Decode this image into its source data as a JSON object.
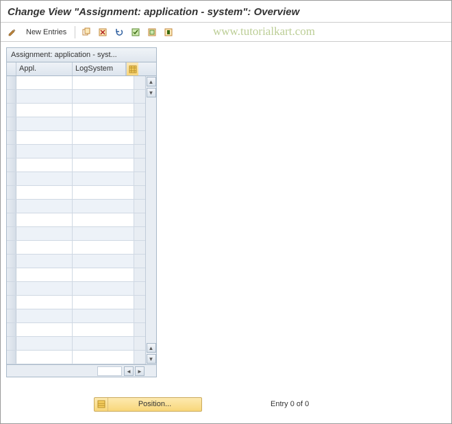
{
  "title": "Change View \"Assignment: application - system\": Overview",
  "watermark": "www.tutorialkart.com",
  "toolbar": {
    "new_entries_label": "New Entries"
  },
  "table": {
    "title": "Assignment: application - syst...",
    "col1": "Appl.",
    "col2": "LogSystem",
    "rows": [
      {
        "appl": "",
        "logsys": ""
      },
      {
        "appl": "",
        "logsys": ""
      },
      {
        "appl": "",
        "logsys": ""
      },
      {
        "appl": "",
        "logsys": ""
      },
      {
        "appl": "",
        "logsys": ""
      },
      {
        "appl": "",
        "logsys": ""
      },
      {
        "appl": "",
        "logsys": ""
      },
      {
        "appl": "",
        "logsys": ""
      },
      {
        "appl": "",
        "logsys": ""
      },
      {
        "appl": "",
        "logsys": ""
      },
      {
        "appl": "",
        "logsys": ""
      },
      {
        "appl": "",
        "logsys": ""
      },
      {
        "appl": "",
        "logsys": ""
      },
      {
        "appl": "",
        "logsys": ""
      },
      {
        "appl": "",
        "logsys": ""
      },
      {
        "appl": "",
        "logsys": ""
      },
      {
        "appl": "",
        "logsys": ""
      },
      {
        "appl": "",
        "logsys": ""
      },
      {
        "appl": "",
        "logsys": ""
      },
      {
        "appl": "",
        "logsys": ""
      },
      {
        "appl": "",
        "logsys": ""
      }
    ]
  },
  "footer": {
    "position_label": "Position...",
    "entry_text": "Entry 0 of 0"
  }
}
